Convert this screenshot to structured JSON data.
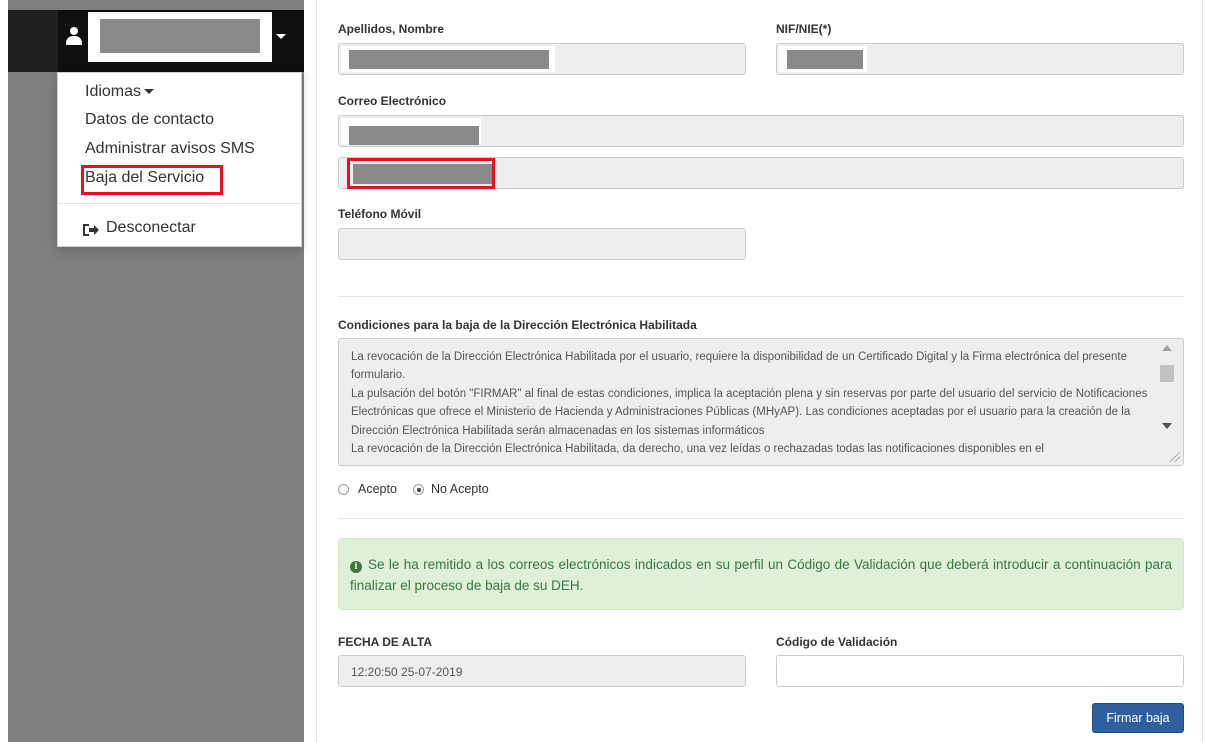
{
  "user_menu": {
    "items": [
      {
        "label": "Idiomas"
      },
      {
        "label": "Datos de contacto"
      },
      {
        "label": "Administrar avisos SMS"
      },
      {
        "label": "Baja del Servicio"
      }
    ],
    "signout_label": "Desconectar"
  },
  "form": {
    "name_label": "Apellidos, Nombre",
    "nif_label": "NIF/NIE(*)",
    "email_label": "Correo Electrónico",
    "phone_label": "Teléfono Móvil",
    "conditions": {
      "title": "Condiciones para la baja de la Dirección Electrónica Habilitada",
      "lines": [
        "La revocación  de la Dirección Electrónica Habilitada por el usuario, requiere la disponibilidad de un Certificado Digital y la Firma electrónica del presente formulario.",
        "La pulsación del botón \"FIRMAR\" al final de estas condiciones, implica la aceptación plena y sin reservas por parte del usuario del servicio de Notificaciones Electrónicas que ofrece el Ministerio de Hacienda y Administraciones Públicas (MHyAP).  Las condiciones aceptadas por el usuario para la creación de la Dirección Electrónica Habilitada serán almacenadas en los sistemas informáticos",
        "La revocación de la Dirección Electrónica Habilitada, da derecho, una vez leídas o rechazadas todas las notificaciones disponibles en el"
      ]
    },
    "accept_label": "Acepto",
    "reject_label": "No Acepto",
    "selected_option": "No Acepto",
    "alert_text": "Se le ha remitido a los correos electrónicos indicados en su perfil un Código de Validación que deberá introducir a continuación para finalizar el proceso de baja de su DEH.",
    "date_label": "FECHA DE ALTA",
    "date_value": "12:20:50 25-07-2019",
    "code_label": "Código de Validación",
    "code_value": "",
    "submit_label": "Firmar baja"
  },
  "colors": {
    "highlight": "#e0141e",
    "button": "#2e5f9e",
    "alert_bg": "#dff0d8",
    "alert_text": "#3c763d"
  },
  "icons": [
    "user-icon",
    "chevron-down-icon",
    "sign-out-icon",
    "info-circle-icon"
  ]
}
